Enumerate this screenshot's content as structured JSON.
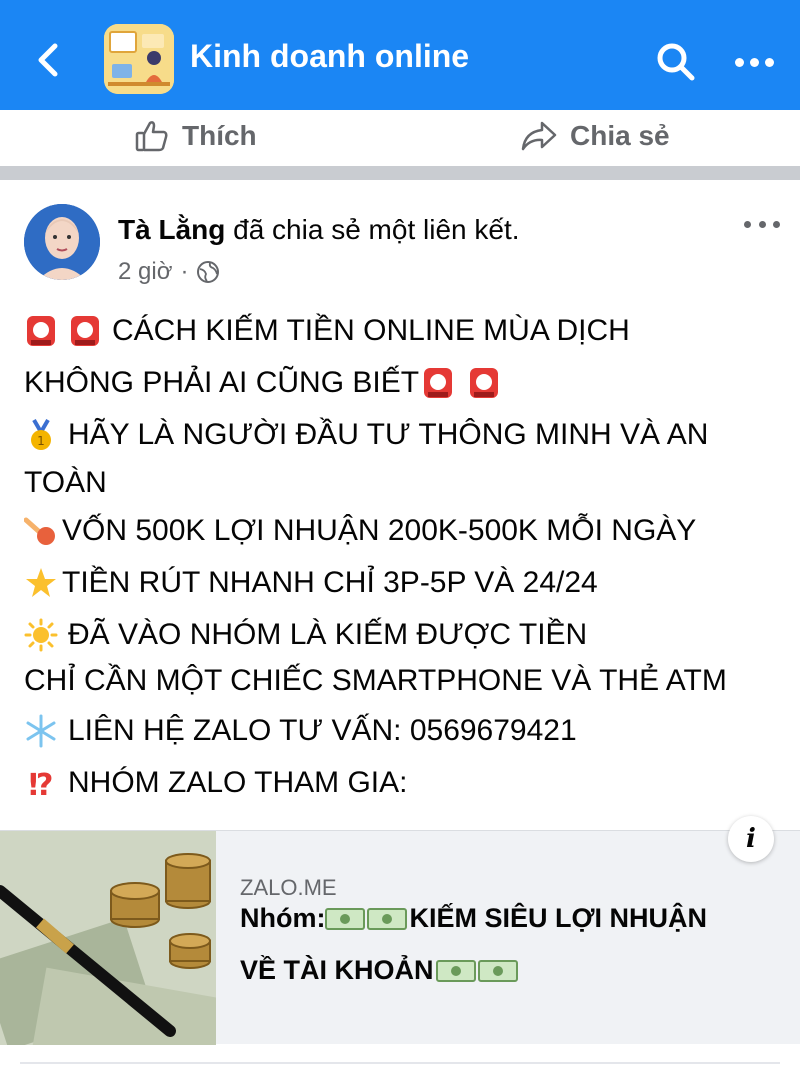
{
  "header": {
    "group_title": "Kinh doanh online",
    "accent_color": "#1b86f4",
    "icons": [
      "back-arrow-icon",
      "search-icon",
      "more-icon"
    ]
  },
  "actions": {
    "like_label": "Thích",
    "share_label": "Chia sẻ"
  },
  "post": {
    "author": "Tà Lằng",
    "author_action": "đã chia sẻ một liên kết.",
    "time": "2 giờ",
    "separator": "·",
    "privacy_icon": "globe-icon",
    "lines": [
      {
        "emoji": "siren",
        "emoji2": "siren",
        "text": "CÁCH KIẾM TIỀN ONLINE MÙA DỊCH"
      },
      {
        "text": "KHÔNG PHẢI AI CŨNG BIẾT",
        "trailing_emoji": "siren siren"
      },
      {
        "emoji": "medal",
        "text": "HÃY LÀ NGƯỜI ĐẦU TƯ THÔNG MINH VÀ AN"
      },
      {
        "text": "TOÀN"
      },
      {
        "emoji": "comet",
        "text": "VỐN 500K LỢI NHUẬN 200K-500K MỖI NGÀY"
      },
      {
        "emoji": "star",
        "text": "TIỀN RÚT NHANH CHỈ 3P-5P VÀ 24/24"
      },
      {
        "emoji": "sun",
        "text": "ĐÃ VÀO NHÓM LÀ KIẾM ĐƯỢC TIỀN"
      },
      {
        "text": "CHỈ CẦN MỘT CHIẾC SMARTPHONE VÀ THẺ ATM"
      },
      {
        "emoji": "snowflake",
        "text": "LIÊN HỆ ZALO TƯ VẤN: 0569679421"
      },
      {
        "emoji": "interrobang",
        "text": "NHÓM ZALO THAM GIA:"
      }
    ]
  },
  "link_card": {
    "domain": "ZALO.ME",
    "title_line1": "Nhóm: ",
    "title_line1_rest": "KIẾM SIÊU LỢI NHUẬN",
    "title_line2": "VỀ TÀI KHOẢN",
    "inline_icon": "money-icon",
    "info_label": "i"
  }
}
